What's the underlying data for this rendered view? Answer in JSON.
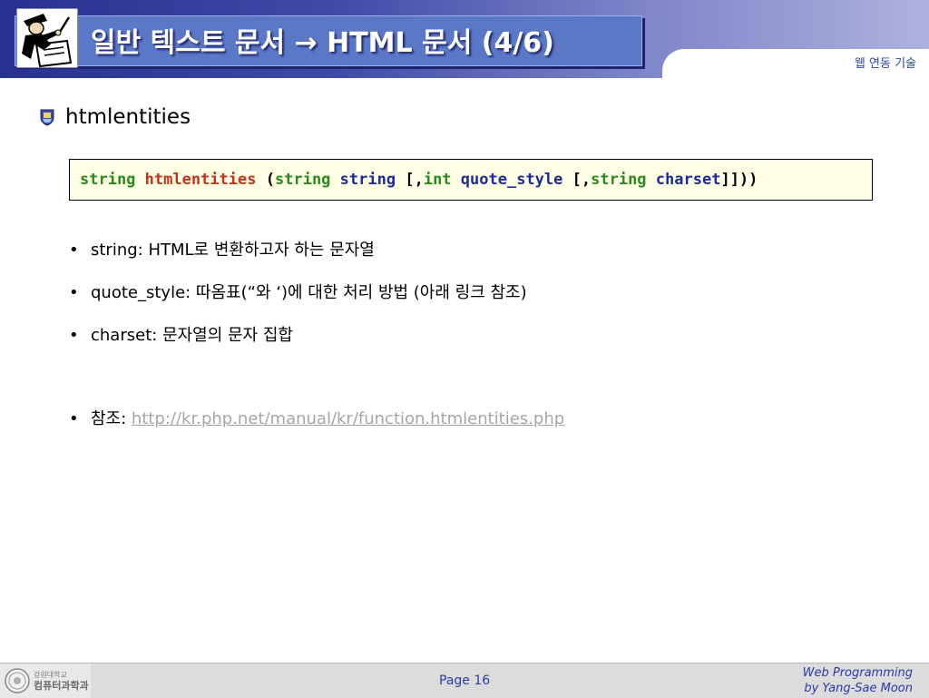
{
  "header": {
    "title": "일반 텍스트 문서 → HTML 문서 (4/6)",
    "course": "웹 연동 기술"
  },
  "section": {
    "heading": "htmlentities"
  },
  "code": {
    "t1": "string",
    "fn": "htmlentities",
    "p1": "(",
    "t2": "string",
    "a1": "string",
    "p2": "[,",
    "t3": "int",
    "a2": "quote_style",
    "p3": "[,",
    "t4": "string",
    "a3": "charset",
    "p4": "]]))"
  },
  "bullets": [
    {
      "text": "string: HTML로 변환하고자 하는 문자열"
    },
    {
      "text": "quote_style: 따옴표(“와 ‘)에 대한 처리 방법 (아래 링크 참조)"
    },
    {
      "text": "charset: 문자열의 문자 집합"
    }
  ],
  "reference": {
    "label": "참조: ",
    "url": "http://kr.php.net/manual/kr/function.htmlentities.php"
  },
  "bullet_char": "•",
  "footer": {
    "university_line1": "강원대학교",
    "university_line2": "컴퓨터과학과",
    "page": "Page 16",
    "credit_line1": "Web Programming",
    "credit_line2": "by Yang-Sae Moon"
  },
  "colors": {
    "header_start": "#28318f",
    "header_end": "#aeb2dd",
    "title_box": "#5b78c6",
    "code_bg": "#ffffe6",
    "code_type": "#2a8a1e",
    "code_func": "#c8321a",
    "code_param": "#1c2aa0",
    "link": "#a6a6a6",
    "footer_text": "#2b3aa7"
  },
  "icons": {
    "header_logo": "person-writing-icon",
    "bullet": "emblem-bullet-icon",
    "footer_seal": "university-seal-icon"
  }
}
